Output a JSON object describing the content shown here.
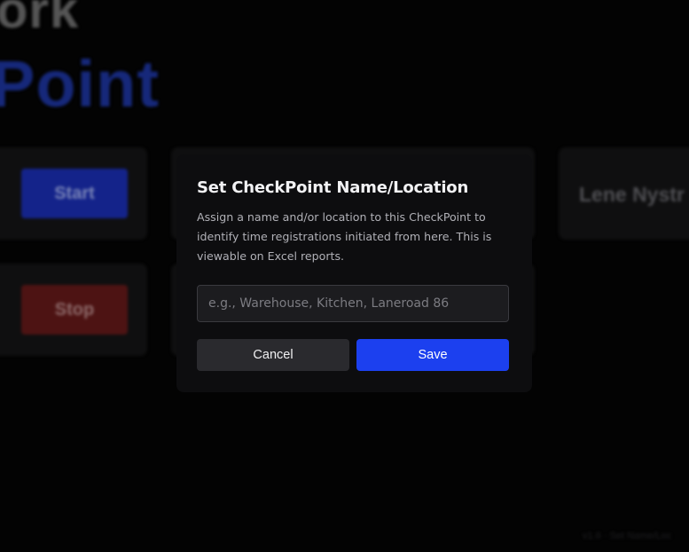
{
  "background": {
    "logo": {
      "line1": "ork",
      "line2": "Point"
    },
    "start_button": "Start",
    "stop_button": "Stop",
    "user_name": "Lene Nystr",
    "footer": "v1.6 · Set Name/Loc"
  },
  "modal": {
    "title": "Set CheckPoint Name/Location",
    "description": "Assign a name and/or location to this CheckPoint to identify time registrations initiated from here. This is viewable on Excel reports.",
    "input": {
      "value": "",
      "placeholder": "e.g., Warehouse, Kitchen, Laneroad 86"
    },
    "cancel_label": "Cancel",
    "save_label": "Save"
  },
  "colors": {
    "accent": "#1c40ef",
    "cancel": "#2a2a2e",
    "stop": "#4d1313"
  }
}
